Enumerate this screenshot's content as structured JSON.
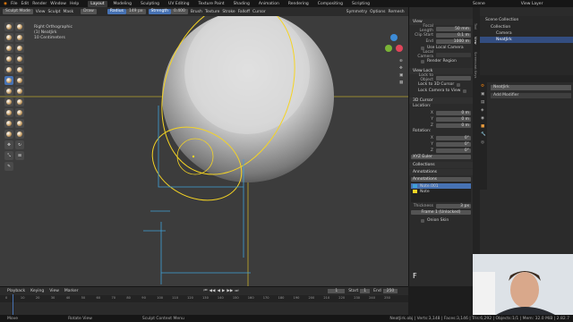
{
  "menubar": {
    "menus": [
      "File",
      "Edit",
      "Render",
      "Window",
      "Help"
    ],
    "workspaces": [
      "Layout",
      "Modeling",
      "Sculpting",
      "UV Editing",
      "Texture Paint",
      "Shading",
      "Animation",
      "Rendering",
      "Compositing",
      "Scripting"
    ],
    "active_workspace": "Layout",
    "scene": "Scene",
    "view_layer": "View Layer"
  },
  "header": {
    "mode": "Sculpt Mode",
    "view": "View",
    "sculpt": "Sculpt",
    "mask": "Mask",
    "brush": "Draw",
    "radius_label": "Radius",
    "radius_value": "149 px",
    "strength_label": "Strength",
    "strength_value": "0.400",
    "brush_menu": "Brush",
    "texture_menu": "Texture",
    "stroke_menu": "Stroke",
    "falloff_menu": "Falloff",
    "cursor_menu": "Cursor",
    "symmetry": "Symmetry",
    "options": "Options",
    "remesh": "Remesh"
  },
  "viewport": {
    "view_name": "Right Orthographic",
    "object_info": "(1) NeatJirk",
    "extra_info": "10 Centimeters"
  },
  "npanel": {
    "view_header": "View",
    "focal_length_label": "Focal Length",
    "focal_length_value": "50 mm",
    "clip_start_label": "Clip Start",
    "clip_start_value": "0.1 m",
    "clip_end_label": "End",
    "clip_end_value": "1000 m",
    "use_local_camera": "Use Local Camera",
    "local_camera_label": "Local Camera",
    "render_region": "Render Region",
    "view_lock_header": "View Lock",
    "lock_to_object_label": "Lock to Object",
    "lock_to_3d_cursor": "Lock to 3D Cursor",
    "lock_camera_to_view": "Lock Camera to View",
    "cursor_header": "3D Cursor",
    "location_label": "Location:",
    "x_label": "X",
    "y_label": "Y",
    "z_label": "Z",
    "x_value": "0 m",
    "y_value": "0 m",
    "z_value": "0 m",
    "rotation_label": "Rotation:",
    "rx_value": "0°",
    "ry_value": "0°",
    "rz_value": "0°",
    "rotation_mode": "XYZ Euler",
    "collections_header": "Collections",
    "annotations_header": "Annotations",
    "annotation_name": "Annotations",
    "note1": "Note.001",
    "note2": "Note",
    "thickness_label": "Thickness",
    "thickness_value": "3 px",
    "frame_mode": "Frame 1 (Unlocked)",
    "onion_skin": "Onion Skin"
  },
  "vtabs": [
    "Tool",
    "View",
    "Screencast Keys"
  ],
  "outliner": {
    "title": "Scene Collection",
    "items": [
      "Collection",
      "Camera",
      "NeatJirk"
    ]
  },
  "properties": {
    "object_name": "NeatJirk",
    "add_modifier": "Add Modifier"
  },
  "timeline": {
    "playback": "Playback",
    "keying": "Keying",
    "view": "View",
    "marker": "Marker",
    "current_frame": "1",
    "start_label": "Start",
    "start_value": "1",
    "end_label": "End",
    "end_value": "250",
    "ticks": [
      "0",
      "10",
      "20",
      "30",
      "40",
      "50",
      "60",
      "70",
      "80",
      "90",
      "100",
      "110",
      "120",
      "130",
      "140",
      "150",
      "160",
      "170",
      "180",
      "190",
      "200",
      "210",
      "220",
      "230",
      "240",
      "250"
    ]
  },
  "status": {
    "left1": "Move",
    "left2": "Rotate View",
    "left3": "Sculpt Context Menu",
    "right": "NeatJirk.obj | Verts:3,148 | Faces:3,146 | Tris:6,292 | Objects:1/1 | Mem: 32.0 MiB | 2.82.7"
  },
  "keycast_letter": "F",
  "colors": {
    "accent": "#4772b3",
    "annotation_yellow": "#f5d424",
    "annotation_blue": "#3fa0d8",
    "background": "#3c3c3c"
  }
}
